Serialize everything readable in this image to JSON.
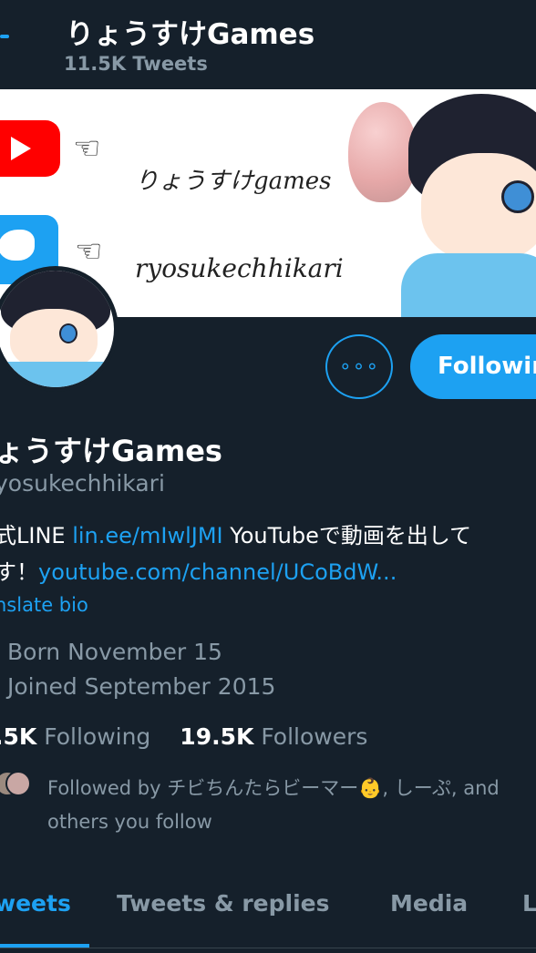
{
  "header": {
    "title": "りょうすけGames",
    "tweet_count": "11.5K Tweets"
  },
  "banner": {
    "handle_youtube": "りょうすけgames",
    "handle_twitter": "ryosukechhikari"
  },
  "actions": {
    "more_label": "∘∘∘",
    "follow_label": "Following"
  },
  "profile": {
    "name": "ょうすけGames",
    "handle": "yosukechhikari",
    "bio_line1_prefix": "式LINE ",
    "bio_line1_link": "lin.ee/mIwlJMI",
    "bio_line1_suffix": "   YouTubeで動画を出して",
    "bio_line2_prefix": "す！",
    "bio_line2_link": "youtube.com/channel/UCoBdW...",
    "translate": "nslate bio",
    "born": "Born November 15",
    "joined": "Joined September 2015",
    "following_count": ".5K",
    "following_label": "Following",
    "followers_count": "19.5K",
    "followers_label": "Followers",
    "followed_by_line1": "Followed by チビちんたらビーマー👶, しーぷ, and",
    "followed_by_line2": "others you follow"
  },
  "tabs": [
    {
      "label": "weets"
    },
    {
      "label": "Tweets & replies"
    },
    {
      "label": "Media"
    },
    {
      "label": "L"
    }
  ],
  "colors": {
    "background": "#15202b",
    "accent": "#1da1f2",
    "muted": "#8899a6"
  }
}
